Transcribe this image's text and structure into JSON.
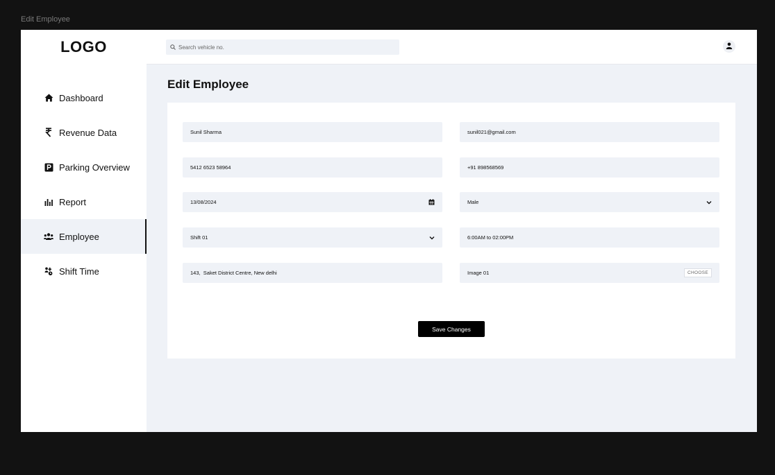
{
  "window": {
    "title": "Edit Employee"
  },
  "brand": {
    "logo": "LOGO"
  },
  "search": {
    "placeholder": "Search vehicle no.",
    "value": ""
  },
  "nav": {
    "items": [
      {
        "label": "Dashboard",
        "icon": "home-icon"
      },
      {
        "label": "Revenue Data",
        "icon": "rupee-icon"
      },
      {
        "label": "Parking Overview",
        "icon": "parking-icon"
      },
      {
        "label": "Report",
        "icon": "bar-chart-icon"
      },
      {
        "label": "Employee",
        "icon": "users-icon",
        "active": true
      },
      {
        "label": "Shift Time",
        "icon": "shift-icon"
      }
    ]
  },
  "page": {
    "title": "Edit Employee"
  },
  "form": {
    "name": "Sunil Sharma",
    "email": "sunil021@gmail.com",
    "id_number": "5412 6523 58964",
    "phone": "+91 898568569",
    "date": "13/08/2024",
    "gender": "Male",
    "shift": "Shift 01",
    "shift_time": "6:00AM to 02:00PM",
    "address": "143,  Saket District Centre, New delhi",
    "image": "Image 01",
    "choose_label": "CHOOSE",
    "save_label": "Save Changes"
  },
  "colors": {
    "accent": "#000000",
    "background": "#eff2f7",
    "surface": "#ffffff"
  }
}
